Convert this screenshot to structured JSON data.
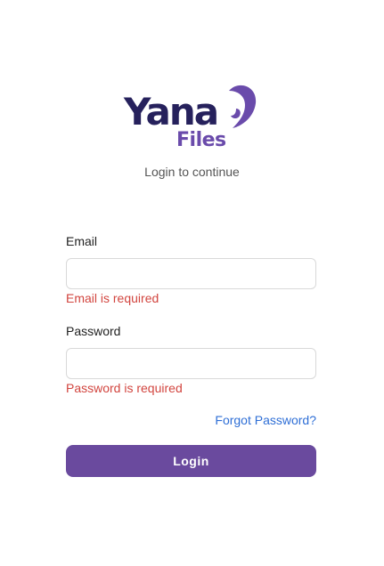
{
  "logo": {
    "word": "Yana",
    "sub": "Files",
    "mark_icon": "yana-swirl-icon"
  },
  "subtitle": "Login to continue",
  "form": {
    "email": {
      "label": "Email",
      "value": "",
      "placeholder": "",
      "error": "Email is required"
    },
    "password": {
      "label": "Password",
      "value": "",
      "placeholder": "",
      "error": "Password is required"
    },
    "forgot_label": "Forgot Password?",
    "submit_label": "Login"
  },
  "colors": {
    "brand_dark": "#26215c",
    "brand_purple": "#6a4bab",
    "button": "#6a4a9e",
    "error": "#d2453f",
    "link": "#2f6fd6"
  }
}
